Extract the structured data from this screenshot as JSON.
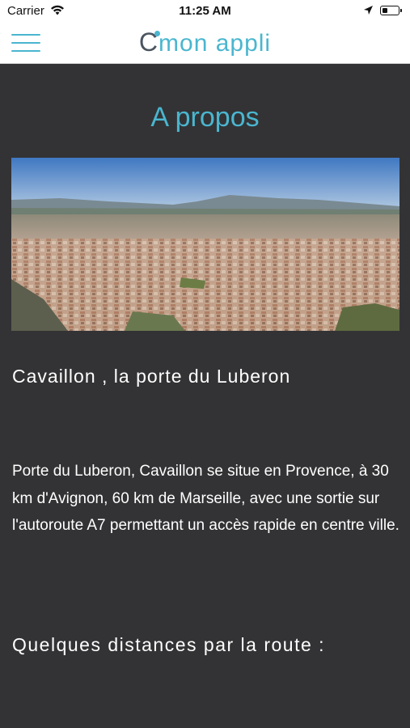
{
  "status_bar": {
    "carrier": "Carrier",
    "time": "11:25 AM",
    "icons": [
      "wifi-icon",
      "location-arrow-icon",
      "battery-icon"
    ]
  },
  "nav_bar": {
    "logo_c": "C",
    "logo_rest": "mon appli",
    "menu_icon": "hamburger-menu-icon"
  },
  "content": {
    "title": "A propos",
    "hero_image": "aerial-view-of-cavaillon-town",
    "heading": "Cavaillon , la porte du Luberon",
    "paragraph": "Porte du Luberon, Cavaillon se situe en Provence, à 30 km d'Avignon, 60 km de Marseille, avec une sortie sur l'autoroute A7 permettant un accès rapide en centre ville.",
    "subheading": "Quelques distances par la route :"
  },
  "colors": {
    "accent": "#4ab6cf",
    "background": "#333335",
    "text": "#ffffff"
  }
}
